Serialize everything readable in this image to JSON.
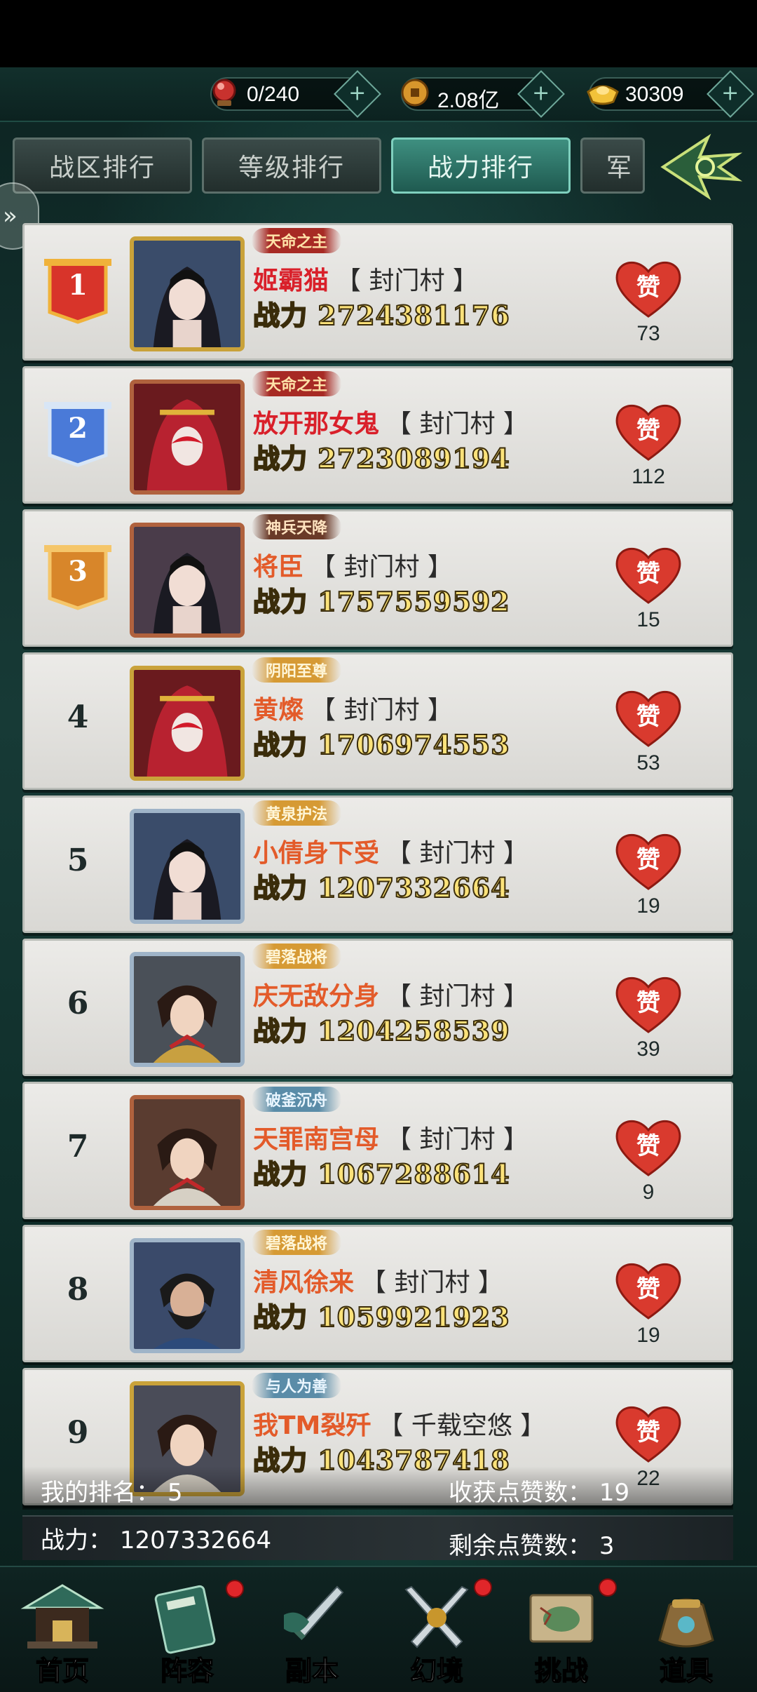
{
  "resources": [
    {
      "name": "stamina",
      "icon": "red-orb-icon",
      "value": "0/240"
    },
    {
      "name": "copper",
      "icon": "copper-coin-icon",
      "value": "2.08亿"
    },
    {
      "name": "gold",
      "icon": "gold-ingot-icon",
      "value": "30309"
    }
  ],
  "tabs": [
    {
      "label": "战区排行",
      "active": false
    },
    {
      "label": "等级排行",
      "active": false
    },
    {
      "label": "战力排行",
      "active": true
    },
    {
      "label": "军",
      "active": false
    }
  ],
  "power_prefix": "战力",
  "rows": [
    {
      "rank": "1",
      "title": "天命之主",
      "name": "姬霸猫",
      "guild": "【 封门村 】",
      "power": "2724381176",
      "likes": "73"
    },
    {
      "rank": "2",
      "title": "天命之主",
      "name": "放开那女鬼",
      "guild": "【 封门村 】",
      "power": "2723089194",
      "likes": "112"
    },
    {
      "rank": "3",
      "title": "神兵天降",
      "name": "将臣",
      "guild": "【 封门村 】",
      "power": "1757559592",
      "likes": "15"
    },
    {
      "rank": "4",
      "title": "阴阳至尊",
      "name": "黄燦",
      "guild": "【 封门村 】",
      "power": "1706974553",
      "likes": "53"
    },
    {
      "rank": "5",
      "title": "黄泉护法",
      "name": "小倩身下受",
      "guild": "【 封门村 】",
      "power": "1207332664",
      "likes": "19"
    },
    {
      "rank": "6",
      "title": "碧落战将",
      "name": "庆无敌分身",
      "guild": "【 封门村 】",
      "power": "1204258539",
      "likes": "39"
    },
    {
      "rank": "7",
      "title": "破釜沉舟",
      "name": "天罪南宫母",
      "guild": "【 封门村 】",
      "power": "1067288614",
      "likes": "9"
    },
    {
      "rank": "8",
      "title": "碧落战将",
      "name": "清风徐来",
      "guild": "【 封门村 】",
      "power": "1059921923",
      "likes": "19"
    },
    {
      "rank": "9",
      "title": "与人为善",
      "name": "我TM裂歼",
      "guild": "【 千载空悠 】",
      "power": "1043787418",
      "likes": "22"
    }
  ],
  "like_label": "赞",
  "mine": {
    "rank_label": "我的排名：",
    "rank_value": "5",
    "received_label": "收获点赞数：",
    "received_value": "19",
    "power_label": "战力：",
    "power_value": "1207332664",
    "remaining_label": "剩余点赞数：",
    "remaining_value": "3"
  },
  "nav": [
    {
      "label": "首页",
      "icon": "home-pavilion-icon",
      "badge": false
    },
    {
      "label": "阵容",
      "icon": "scroll-book-icon",
      "badge": true
    },
    {
      "label": "副本",
      "icon": "sword-icon",
      "badge": false
    },
    {
      "label": "幻境",
      "icon": "crossed-swords-icon",
      "badge": true
    },
    {
      "label": "挑战",
      "icon": "battle-map-icon",
      "badge": true
    },
    {
      "label": "道具",
      "icon": "treasure-bag-icon",
      "badge": false
    }
  ],
  "colors": {
    "accent_teal": "#3e8f80",
    "power_gold": "#fbe27a",
    "name_orange": "#e35b2a",
    "name_red": "#d9202a",
    "like_red": "#d93a2e"
  }
}
